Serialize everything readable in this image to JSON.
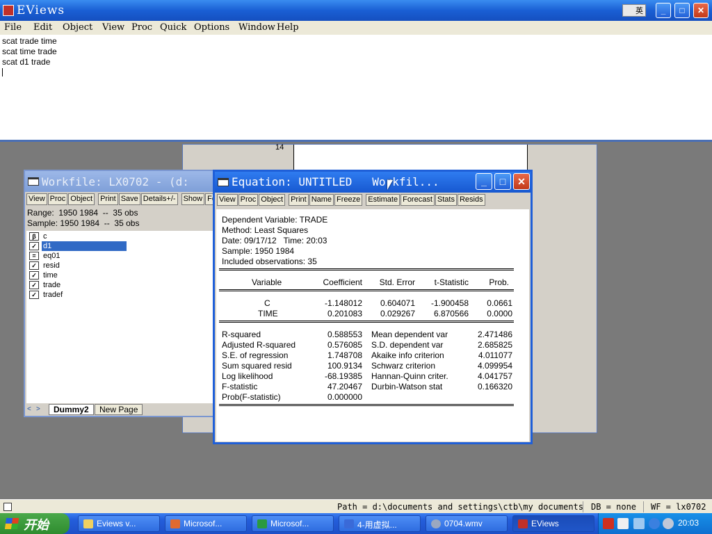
{
  "app": {
    "title": "EViews",
    "ime_label": "英",
    "controls": {
      "minimize": "_",
      "maximize": "□",
      "close": "✕"
    }
  },
  "menu": [
    "File",
    "Edit",
    "Object",
    "View",
    "Proc",
    "Quick",
    "Options",
    "Window",
    "Help"
  ],
  "command_window": {
    "lines": [
      "scat trade time",
      "scat time trade",
      "scat d1 trade"
    ]
  },
  "graph_window": {
    "tick_label": "14"
  },
  "workfile_window": {
    "title": "Workfile: LX0702 - (d:",
    "toolbar": [
      "View",
      "Proc",
      "Object",
      "Print",
      "Save",
      "Details+/-",
      "Show",
      "Fe"
    ],
    "range": "Range:  1950 1984  --  35 obs",
    "sample": "Sample: 1950 1984  --  35 obs",
    "objects": [
      {
        "name": "c",
        "icon": "coefficient-icon",
        "glyph": "β",
        "selected": false
      },
      {
        "name": "d1",
        "icon": "series-icon",
        "glyph": "✓",
        "selected": true
      },
      {
        "name": "eq01",
        "icon": "equation-icon",
        "glyph": "=",
        "selected": false
      },
      {
        "name": "resid",
        "icon": "series-icon",
        "glyph": "✓",
        "selected": false
      },
      {
        "name": "time",
        "icon": "series-icon",
        "glyph": "✓",
        "selected": false
      },
      {
        "name": "trade",
        "icon": "series-icon",
        "glyph": "✓",
        "selected": false
      },
      {
        "name": "tradef",
        "icon": "series-icon",
        "glyph": "✓",
        "selected": false
      }
    ],
    "tabs": [
      "Dummy2",
      "New Page"
    ],
    "active_tab": "Dummy2"
  },
  "equation_window": {
    "title": "Equation: UNTITLED   Workfil...",
    "toolbar": [
      "View",
      "Proc",
      "Object",
      "Print",
      "Name",
      "Freeze",
      "Estimate",
      "Forecast",
      "Stats",
      "Resids"
    ],
    "header": {
      "dependent": "Dependent Variable: TRADE",
      "method": "Method: Least Squares",
      "date": "Date: 09/17/12   Time: 20:03",
      "sample": "Sample: 1950 1984",
      "observations": "Included observations: 35"
    },
    "columns": [
      "Variable",
      "Coefficient",
      "Std. Error",
      "t-Statistic",
      "Prob."
    ],
    "rows": [
      [
        "C",
        "-1.148012",
        "0.604071",
        "-1.900458",
        "0.0661"
      ],
      [
        "TIME",
        "0.201083",
        "0.029267",
        "6.870566",
        "0.0000"
      ]
    ],
    "stats_left": [
      [
        "R-squared",
        "0.588553"
      ],
      [
        "Adjusted R-squared",
        "0.576085"
      ],
      [
        "S.E. of regression",
        "1.748708"
      ],
      [
        "Sum squared resid",
        "100.9134"
      ],
      [
        "Log likelihood",
        "-68.19385"
      ],
      [
        "F-statistic",
        "47.20467"
      ],
      [
        "Prob(F-statistic)",
        "0.000000"
      ]
    ],
    "stats_right": [
      [
        "Mean dependent var",
        "2.471486"
      ],
      [
        "S.D. dependent var",
        "2.685825"
      ],
      [
        "Akaike info criterion",
        "4.011077"
      ],
      [
        "Schwarz criterion",
        "4.099954"
      ],
      [
        "Hannan-Quinn criter.",
        "4.041757"
      ],
      [
        "Durbin-Watson stat",
        "0.166320"
      ]
    ]
  },
  "status_bar": {
    "path": "Path = d:\\documents and settings\\ctb\\my documents",
    "db": "DB = none",
    "wf": "WF = lx0702"
  },
  "taskbar": {
    "start_label": "开始",
    "tasks": [
      {
        "label": "Eviews v...",
        "icon": "folder-icon",
        "color": "#f0d060",
        "active": false
      },
      {
        "label": "Microsof...",
        "icon": "powerpoint-icon",
        "color": "#e06a30",
        "active": false
      },
      {
        "label": "Microsof...",
        "icon": "excel-icon",
        "color": "#2a9a40",
        "active": false
      },
      {
        "label": "4-用虚拟...",
        "icon": "word-icon",
        "color": "#3a6ad8",
        "active": false
      },
      {
        "label": "0704.wmv",
        "icon": "media-player-icon",
        "color": "#9aa8c0",
        "active": false
      },
      {
        "label": "EViews",
        "icon": "eviews-icon",
        "color": "#c0302a",
        "active": true
      }
    ],
    "clock": "20:03"
  },
  "colors": {
    "selection": "#316ac5",
    "title_active": "#1f5fd8",
    "title_inactive": "#7f9fd8"
  }
}
